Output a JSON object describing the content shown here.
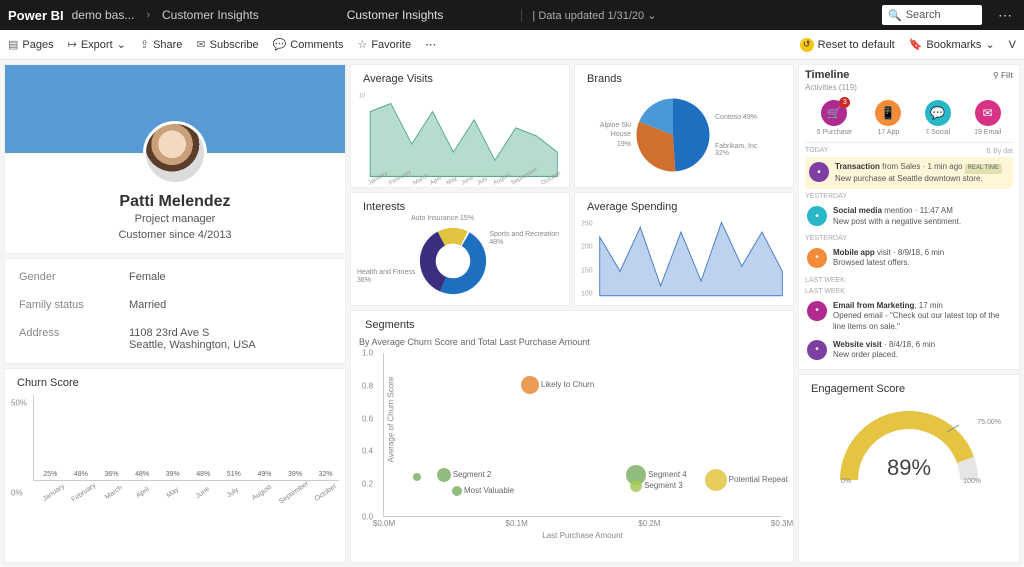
{
  "topbar": {
    "brand": "Power BI",
    "workspace": "demo bas...",
    "report": "Customer Insights",
    "title2": "Customer Insights",
    "updated": "Data updated 1/31/20",
    "search_placeholder": "Search"
  },
  "toolbar": {
    "pages": "Pages",
    "export": "Export",
    "share": "Share",
    "subscribe": "Subscribe",
    "comments": "Comments",
    "favorite": "Favorite",
    "reset": "Reset to default",
    "bookmarks": "Bookmarks",
    "view": "V"
  },
  "profile": {
    "name": "Patti Melendez",
    "title": "Project manager",
    "since": "Customer since 4/2013"
  },
  "details": [
    {
      "label": "Gender",
      "value": "Female"
    },
    {
      "label": "Family status",
      "value": "Married"
    },
    {
      "label": "Address",
      "value": "1108 23rd Ave S\nSeattle, Washington, USA"
    }
  ],
  "churn": {
    "title": "Churn Score",
    "ylabel_top": "50%",
    "ylabel_bottom": "0%"
  },
  "visits": {
    "title": "Average Visits"
  },
  "brands": {
    "title": "Brands",
    "left_lbl": "Alpine Ski House\n19%",
    "right_lbl": "Contoso 49%",
    "bottom_lbl": "Fabrikam, Inc 32%"
  },
  "interests": {
    "title": "Interests",
    "lbl_top": "Auto Insurance 15%",
    "lbl_right": "Sports and Recreation\n48%",
    "lbl_left": "Health and Fitness\n36%"
  },
  "spending": {
    "title": "Average Spending"
  },
  "segments": {
    "title": "Segments",
    "subtitle": "By Average Churn Score and Total Last Purchase Amount",
    "ylabel": "Average of Churn Score",
    "xlabel": "Last Purchase Amount"
  },
  "timeline": {
    "title": "Timeline",
    "filter": "Filt",
    "activities": "Activities (119)",
    "icons": [
      {
        "label": "5 Purchase",
        "color": "#b02a8f",
        "glyph": "🛒",
        "badge": "3"
      },
      {
        "label": "17 App",
        "color": "#f28c38",
        "glyph": "📱"
      },
      {
        "label": "7 Social",
        "color": "#29b6c6",
        "glyph": "💬"
      },
      {
        "label": "19 Email",
        "color": "#d63384",
        "glyph": "✉"
      }
    ],
    "today": "TODAY",
    "bydate": "⇅  By dat",
    "yesterday": "YESTERDAY",
    "lastweek": "LAST WEEK",
    "items": [
      {
        "color": "#7e3fa3",
        "title": "Transaction",
        "meta": " from Sales · 1 min ago",
        "rt": "REAL TIME",
        "sub": "New purchase at Seattle downtown store.",
        "hl": true
      },
      {
        "color": "#29b6c6",
        "title": "Social media",
        "meta": " mention · 11:47 AM",
        "sub": "New post with a negative sentiment."
      },
      {
        "color": "#f28c38",
        "title": "Mobile app",
        "meta": " visit · 8/9/18, 6 min",
        "sub": "Browsed latest offers."
      },
      {
        "color": "#b02a8f",
        "title": "Email from Marketing",
        "meta": ", 17 min",
        "sub": "Opened email - \"Check out our latest top of the line items on sale.\""
      },
      {
        "color": "#7e3fa3",
        "title": "Website visit",
        "meta": " · 8/4/18, 6 min",
        "sub": "New order placed."
      }
    ]
  },
  "engagement": {
    "title": "Engagement Score",
    "value": "89%",
    "left": "0%",
    "right": "100%",
    "target": "75.00%"
  },
  "chart_data": [
    {
      "type": "bar",
      "name": "churn_score",
      "title": "Churn Score",
      "categories": [
        "January",
        "February",
        "March",
        "April",
        "May",
        "June",
        "July",
        "August",
        "September",
        "October"
      ],
      "values": [
        25,
        48,
        36,
        48,
        39,
        48,
        51,
        49,
        39,
        32
      ],
      "ylim": [
        0,
        50
      ],
      "ylabel": "%"
    },
    {
      "type": "area",
      "name": "average_visits",
      "title": "Average Visits",
      "categories": [
        "January",
        "February",
        "March",
        "April",
        "May",
        "June",
        "July",
        "August",
        "September",
        "October"
      ],
      "values": [
        8,
        9,
        4,
        8,
        3,
        7,
        2,
        6,
        5,
        3
      ],
      "ylim": [
        0,
        10
      ]
    },
    {
      "type": "pie",
      "name": "brands",
      "title": "Brands",
      "series": [
        {
          "name": "Contoso",
          "value": 49,
          "color": "#1f6fc1"
        },
        {
          "name": "Fabrikam, Inc",
          "value": 32,
          "color": "#d0702e"
        },
        {
          "name": "Alpine Ski House",
          "value": 19,
          "color": "#4a98d8"
        }
      ]
    },
    {
      "type": "pie",
      "name": "interests_donut",
      "title": "Interests",
      "series": [
        {
          "name": "Sports and Recreation",
          "value": 48,
          "color": "#1f6fc1"
        },
        {
          "name": "Health and Fitness",
          "value": 36,
          "color": "#3b2e7e"
        },
        {
          "name": "Auto Insurance",
          "value": 15,
          "color": "#e0c341"
        }
      ]
    },
    {
      "type": "area",
      "name": "average_spending",
      "title": "Average Spending",
      "x": [
        1,
        2,
        3,
        4,
        5,
        6,
        7,
        8,
        9,
        10
      ],
      "values": [
        220,
        150,
        240,
        120,
        230,
        130,
        250,
        160,
        230,
        150
      ],
      "ylim": [
        100,
        250
      ],
      "yticks": [
        100,
        150,
        200,
        250
      ]
    },
    {
      "type": "scatter",
      "name": "segments",
      "title": "Segments",
      "xlabel": "Last Purchase Amount",
      "ylabel": "Average of Churn Score",
      "xlim": [
        0.0,
        0.3
      ],
      "ylim": [
        0.0,
        1.0
      ],
      "xticks": [
        "$0.0M",
        "$0.1M",
        "$0.2M",
        "$0.3M"
      ],
      "yticks": [
        0.0,
        0.2,
        0.4,
        0.6,
        0.8,
        1.0
      ],
      "points": [
        {
          "label": "Likely to Churn",
          "x": 0.11,
          "y": 0.8,
          "size": 18,
          "color": "#e88b3a"
        },
        {
          "label": "Segment 2",
          "x": 0.045,
          "y": 0.25,
          "size": 14,
          "color": "#7fb069"
        },
        {
          "label": "Most Valuable",
          "x": 0.055,
          "y": 0.15,
          "size": 10,
          "color": "#7fb069"
        },
        {
          "label": "",
          "x": 0.025,
          "y": 0.24,
          "size": 8,
          "color": "#7fb069"
        },
        {
          "label": "Segment 4",
          "x": 0.19,
          "y": 0.25,
          "size": 20,
          "color": "#7fb069"
        },
        {
          "label": "Segment 3",
          "x": 0.19,
          "y": 0.18,
          "size": 12,
          "color": "#a7c957"
        },
        {
          "label": "Potential Repeat",
          "x": 0.25,
          "y": 0.22,
          "size": 22,
          "color": "#e4c441"
        }
      ]
    },
    {
      "type": "bar",
      "name": "engagement_gauge",
      "title": "Engagement Score",
      "value": 89,
      "target": 75,
      "min": 0,
      "max": 100
    }
  ]
}
